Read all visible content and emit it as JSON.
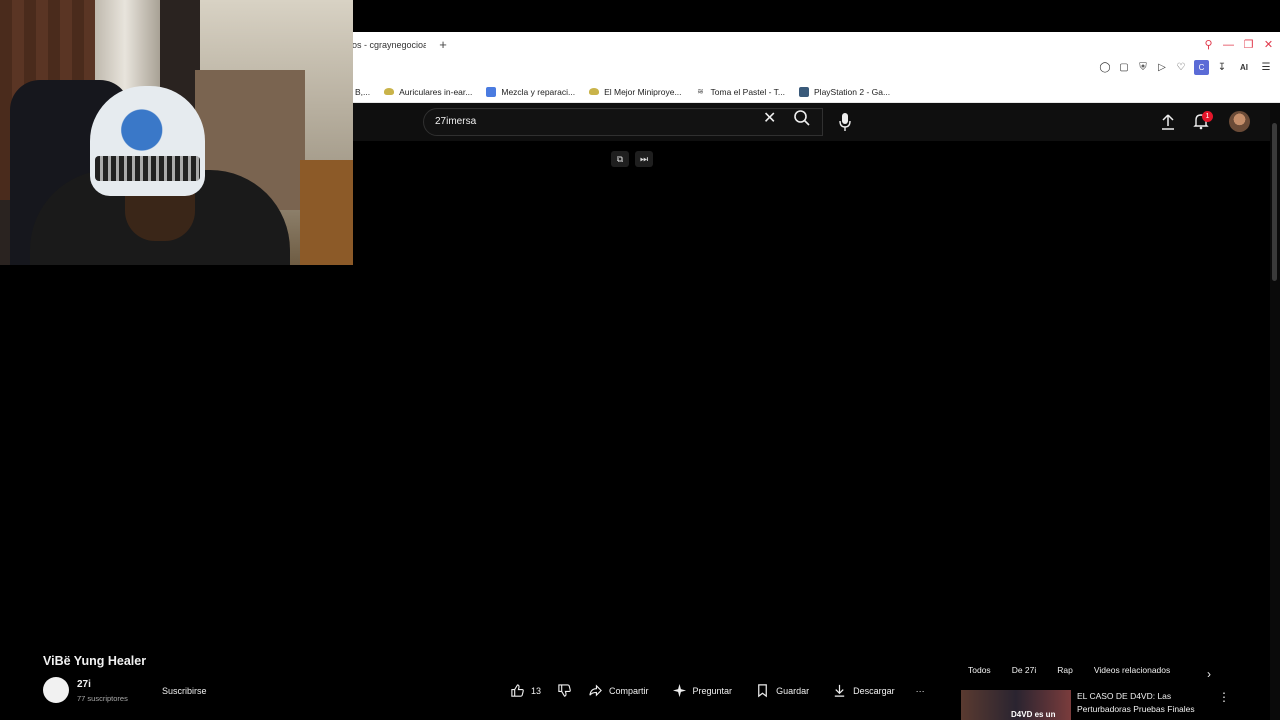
{
  "browser": {
    "tab_title": "os - cgraynegocioa",
    "new_tab": "+",
    "bookmarks": [
      {
        "label": "B,...",
        "icon": "none"
      },
      {
        "label": "Auriculares in-ear...",
        "icon": "burger-icon"
      },
      {
        "label": "Mezcla y reparaci...",
        "icon": "doc-icon"
      },
      {
        "label": "El Mejor Miniproye...",
        "icon": "burger-icon"
      },
      {
        "label": "Toma el Pastel - T...",
        "icon": "eye-icon"
      },
      {
        "label": "PlayStation 2 - Ga...",
        "icon": "ps-icon"
      }
    ],
    "extension_ai_label": "AI",
    "extension_c_label": "C"
  },
  "youtube": {
    "search": {
      "value": "27imersa"
    },
    "notification_count": "1",
    "video": {
      "title": "ViBë Yung Healer",
      "channel_name": "27i",
      "subscribers": "77 suscriptores",
      "subscribe_label": "Suscribirse",
      "likes": "13",
      "share_label": "Compartir",
      "ask_label": "Preguntar",
      "save_label": "Guardar",
      "download_label": "Descargar",
      "more_label": "···"
    },
    "chips": [
      "Todos",
      "De 27i",
      "Rap",
      "Videos relacionados"
    ],
    "related": {
      "title": "EL CASO DE D4VD: Las Perturbadoras Pruebas Finales",
      "thumb_text": "D4VD es un"
    }
  },
  "colors": {
    "background": "#000000",
    "header": "#0f0f0f",
    "text": "#f1f1f1",
    "badge": "#e4162a",
    "window_controls": "#e0384b"
  }
}
